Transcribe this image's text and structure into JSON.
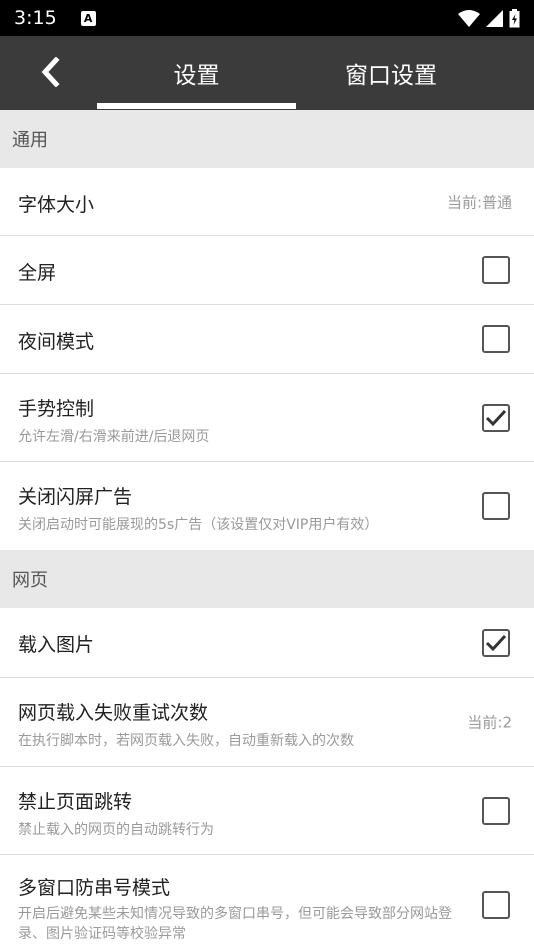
{
  "status_bar": {
    "time": "3:15",
    "notification_icon": "a-notification-icon",
    "icons": [
      "wifi-icon",
      "signal-icon",
      "battery-icon"
    ]
  },
  "app_bar": {
    "back_icon": "chevron-left-icon",
    "tabs": [
      {
        "label": "设置",
        "active": true
      },
      {
        "label": "窗口设置",
        "active": false
      }
    ]
  },
  "sections": {
    "general": {
      "header": "通用",
      "font_size": {
        "title": "字体大小",
        "value": "当前:普通"
      },
      "fullscreen": {
        "title": "全屏",
        "checked": false
      },
      "night_mode": {
        "title": "夜间模式",
        "checked": false
      },
      "gesture": {
        "title": "手势控制",
        "subtitle": "允许左滑/右滑来前进/后退网页",
        "checked": true
      },
      "splash_ad": {
        "title": "关闭闪屏广告",
        "subtitle": "关闭启动时可能展现的5s广告（该设置仅对VIP用户有效）",
        "checked": false
      }
    },
    "web": {
      "header": "网页",
      "load_images": {
        "title": "载入图片",
        "checked": true
      },
      "retry": {
        "title": "网页载入失败重试次数",
        "subtitle": "在执行脚本时，若网页载入失败，自动重新载入的次数",
        "value": "当前:2"
      },
      "no_redirect": {
        "title": "禁止页面跳转",
        "subtitle": "禁止载入的网页的自动跳转行为",
        "checked": false
      },
      "anti_mix": {
        "title": "多窗口防串号模式",
        "subtitle": "开启后避免某些未知情况导致的多窗口串号，但可能会导致部分网站登录、图片验证码等校验异常",
        "checked": false
      }
    }
  },
  "colors": {
    "app_bar": "#3b3b3b",
    "section_bg": "#e8e8e8",
    "checkbox": "#555555"
  }
}
